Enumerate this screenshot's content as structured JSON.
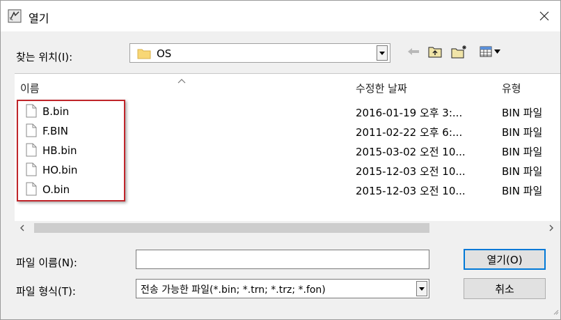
{
  "window": {
    "title": "열기"
  },
  "lookin": {
    "label": "찾는 위치(I):",
    "value": "OS"
  },
  "columns": {
    "name": "이름",
    "date": "수정한 날짜",
    "type": "유형"
  },
  "files": [
    {
      "name": "B.bin",
      "date": "2016-01-19 오후 3:...",
      "type": "BIN 파일"
    },
    {
      "name": "F.BIN",
      "date": "2011-02-22 오후 6:...",
      "type": "BIN 파일"
    },
    {
      "name": "HB.bin",
      "date": "2015-03-02 오전 10...",
      "type": "BIN 파일"
    },
    {
      "name": "HO.bin",
      "date": "2015-12-03 오전 10...",
      "type": "BIN 파일"
    },
    {
      "name": "O.bin",
      "date": "2015-12-03 오전 10...",
      "type": "BIN 파일"
    }
  ],
  "filename": {
    "label": "파일 이름(N):",
    "value": ""
  },
  "filetype": {
    "label": "파일 형식(T):",
    "value": "전송 가능한 파일(*.bin; *.trn; *.trz; *.fon)"
  },
  "buttons": {
    "open": "열기(O)",
    "cancel": "취소"
  },
  "colors": {
    "highlight": "#c0252a",
    "folder": "#f8d775",
    "accent": "#0078d7"
  }
}
